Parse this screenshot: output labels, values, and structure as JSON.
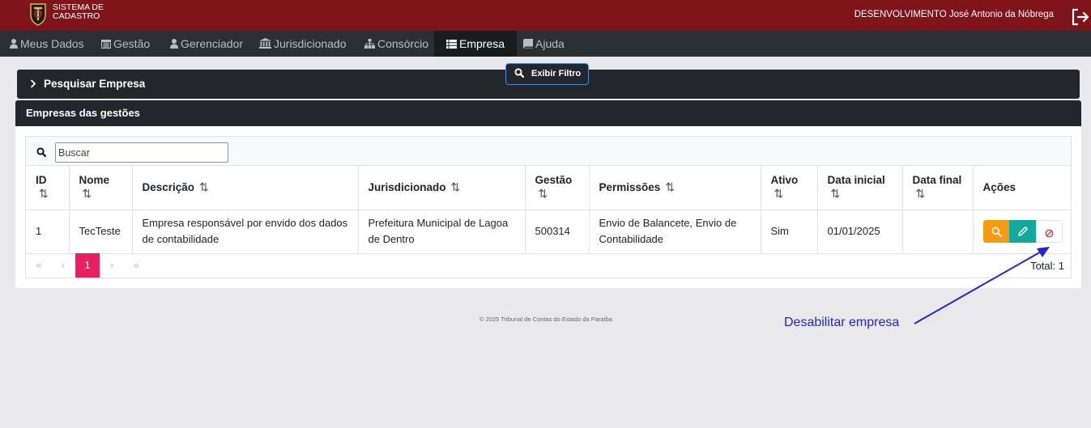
{
  "header": {
    "app_title_line1": "SISTEMA DE",
    "app_title_line2": "CADASTRO",
    "user": "DESENVOLVIMENTO José Antonio da Nóbrega",
    "bg_color": "#7f141a"
  },
  "nav": {
    "items": [
      {
        "label": "Meus Dados",
        "icon": "user-icon"
      },
      {
        "label": "Gestão",
        "icon": "calendar-icon"
      },
      {
        "label": "Gerenciador",
        "icon": "user-icon"
      },
      {
        "label": "Jurisdicionado",
        "icon": "bank-icon"
      },
      {
        "label": "Consórcio",
        "icon": "sitemap-icon"
      },
      {
        "label": "Empresa",
        "icon": "list-icon",
        "active": true
      },
      {
        "label": "Ajuda",
        "icon": "book-icon"
      }
    ]
  },
  "filter": {
    "title": "Pesquisar Empresa",
    "show_button": "Exibir Filtro"
  },
  "card": {
    "title": "Empresas das gestões",
    "search_placeholder": "Buscar"
  },
  "table": {
    "columns": [
      "ID",
      "Nome",
      "Descrição",
      "Jurisdicionado",
      "Gestão",
      "Permissões",
      "Ativo",
      "Data inicial",
      "Data final",
      "Ações"
    ],
    "rows": [
      {
        "id": "1",
        "nome": "TecTeste",
        "descricao": "Empresa responsável por envido dos dados de contabilidade",
        "jurisdicionado": "Prefeitura Municipal de Lagoa de Dentro",
        "gestao": "500314",
        "permissoes": "Envio de Balancete, Envio de Contabilidade",
        "ativo": "Sim",
        "data_inicial": "01/01/2025",
        "data_final": ""
      }
    ]
  },
  "pagination": {
    "first": "«",
    "prev": "‹",
    "current": "1",
    "next": "›",
    "last": "»",
    "total": "Total: 1",
    "accent": "#e91e63"
  },
  "footer": {
    "text": "© 2025 Tribunal de Contas do Estado da Paraíba"
  },
  "annotation": {
    "text": "Desabilitar empresa",
    "color": "#2323d8"
  }
}
